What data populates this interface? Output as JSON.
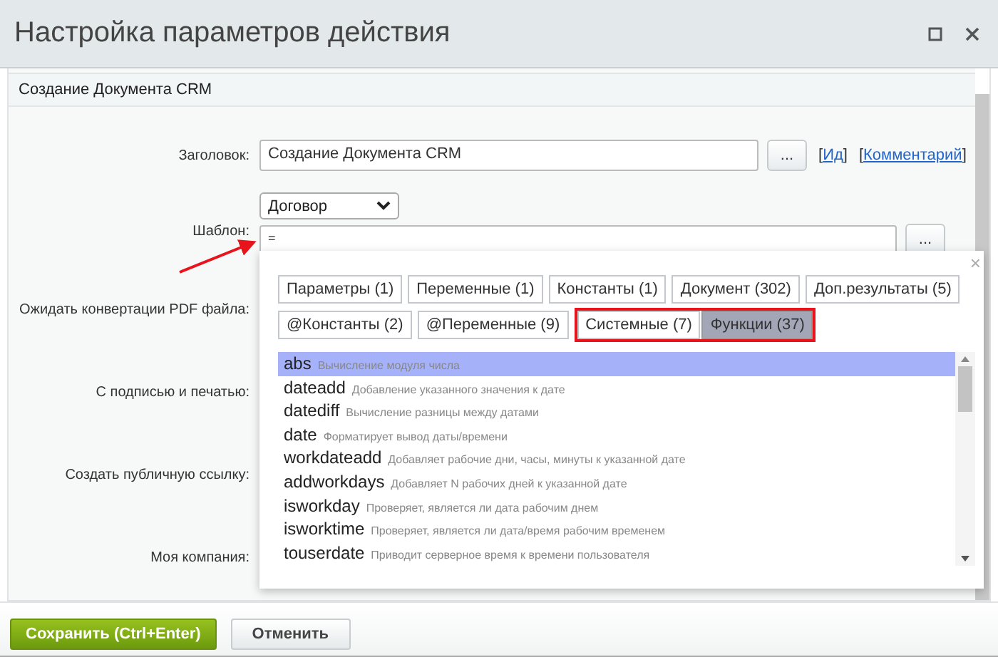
{
  "window": {
    "title": "Настройка параметров действия"
  },
  "section": {
    "title": "Создание Документа CRM"
  },
  "title_field": {
    "label": "Заголовок:",
    "value": "Создание Документа CRM",
    "button": "...",
    "links": [
      {
        "before": "[",
        "text": "Ид",
        "after": "]"
      },
      {
        "before": "[",
        "text": "Комментарий",
        "after": "]"
      }
    ]
  },
  "template_field": {
    "label": "Шаблон:",
    "select": "Договор",
    "value": "=",
    "button": "..."
  },
  "rows": [
    {
      "label": "Ожидать конвертации PDF файла:"
    },
    {
      "label": "С подписью и печатью:"
    },
    {
      "label": "Создать публичную ссылку:"
    },
    {
      "label": "Моя компания:"
    }
  ],
  "popup": {
    "close": "×",
    "tab_rows": [
      [
        {
          "label": "Параметры (1)",
          "selected": false,
          "highlighted": false
        },
        {
          "label": "Переменные (1)",
          "selected": false,
          "highlighted": false
        },
        {
          "label": "Константы (1)",
          "selected": false,
          "highlighted": false
        },
        {
          "label": "Документ (302)",
          "selected": false,
          "highlighted": false
        },
        {
          "label": "Доп.результаты (5)",
          "selected": false,
          "highlighted": false
        }
      ],
      [
        {
          "label": "@Константы (2)",
          "selected": false,
          "highlighted": false
        },
        {
          "label": "@Переменные (9)",
          "selected": false,
          "highlighted": false
        },
        {
          "label": "Системные (7)",
          "selected": false,
          "highlighted": true
        },
        {
          "label": "Функции (37)",
          "selected": true,
          "highlighted": true
        }
      ]
    ],
    "items": [
      {
        "name": "abs",
        "description": "Вычисление модуля числа",
        "selected": true
      },
      {
        "name": "dateadd",
        "description": "Добавление указанного значения к дате",
        "selected": false
      },
      {
        "name": "datediff",
        "description": "Вычисление разницы между датами",
        "selected": false
      },
      {
        "name": "date",
        "description": "Форматирует вывод даты/времени",
        "selected": false
      },
      {
        "name": "workdateadd",
        "description": "Добавляет рабочие дни, часы, минуты к указанной дате",
        "selected": false
      },
      {
        "name": "addworkdays",
        "description": "Добавляет N рабочих дней к указанной дате",
        "selected": false
      },
      {
        "name": "isworkday",
        "description": "Проверяет, является ли дата рабочим днем",
        "selected": false
      },
      {
        "name": "isworktime",
        "description": "Проверяет, является ли дата/время рабочим временем",
        "selected": false
      },
      {
        "name": "touserdate",
        "description": "Приводит серверное время к времени пользователя",
        "selected": false
      }
    ]
  },
  "buttons": [
    {
      "label": "Сохранить (Ctrl+Enter)",
      "kind": "primary"
    },
    {
      "label": "Отменить",
      "kind": "secondary"
    }
  ]
}
